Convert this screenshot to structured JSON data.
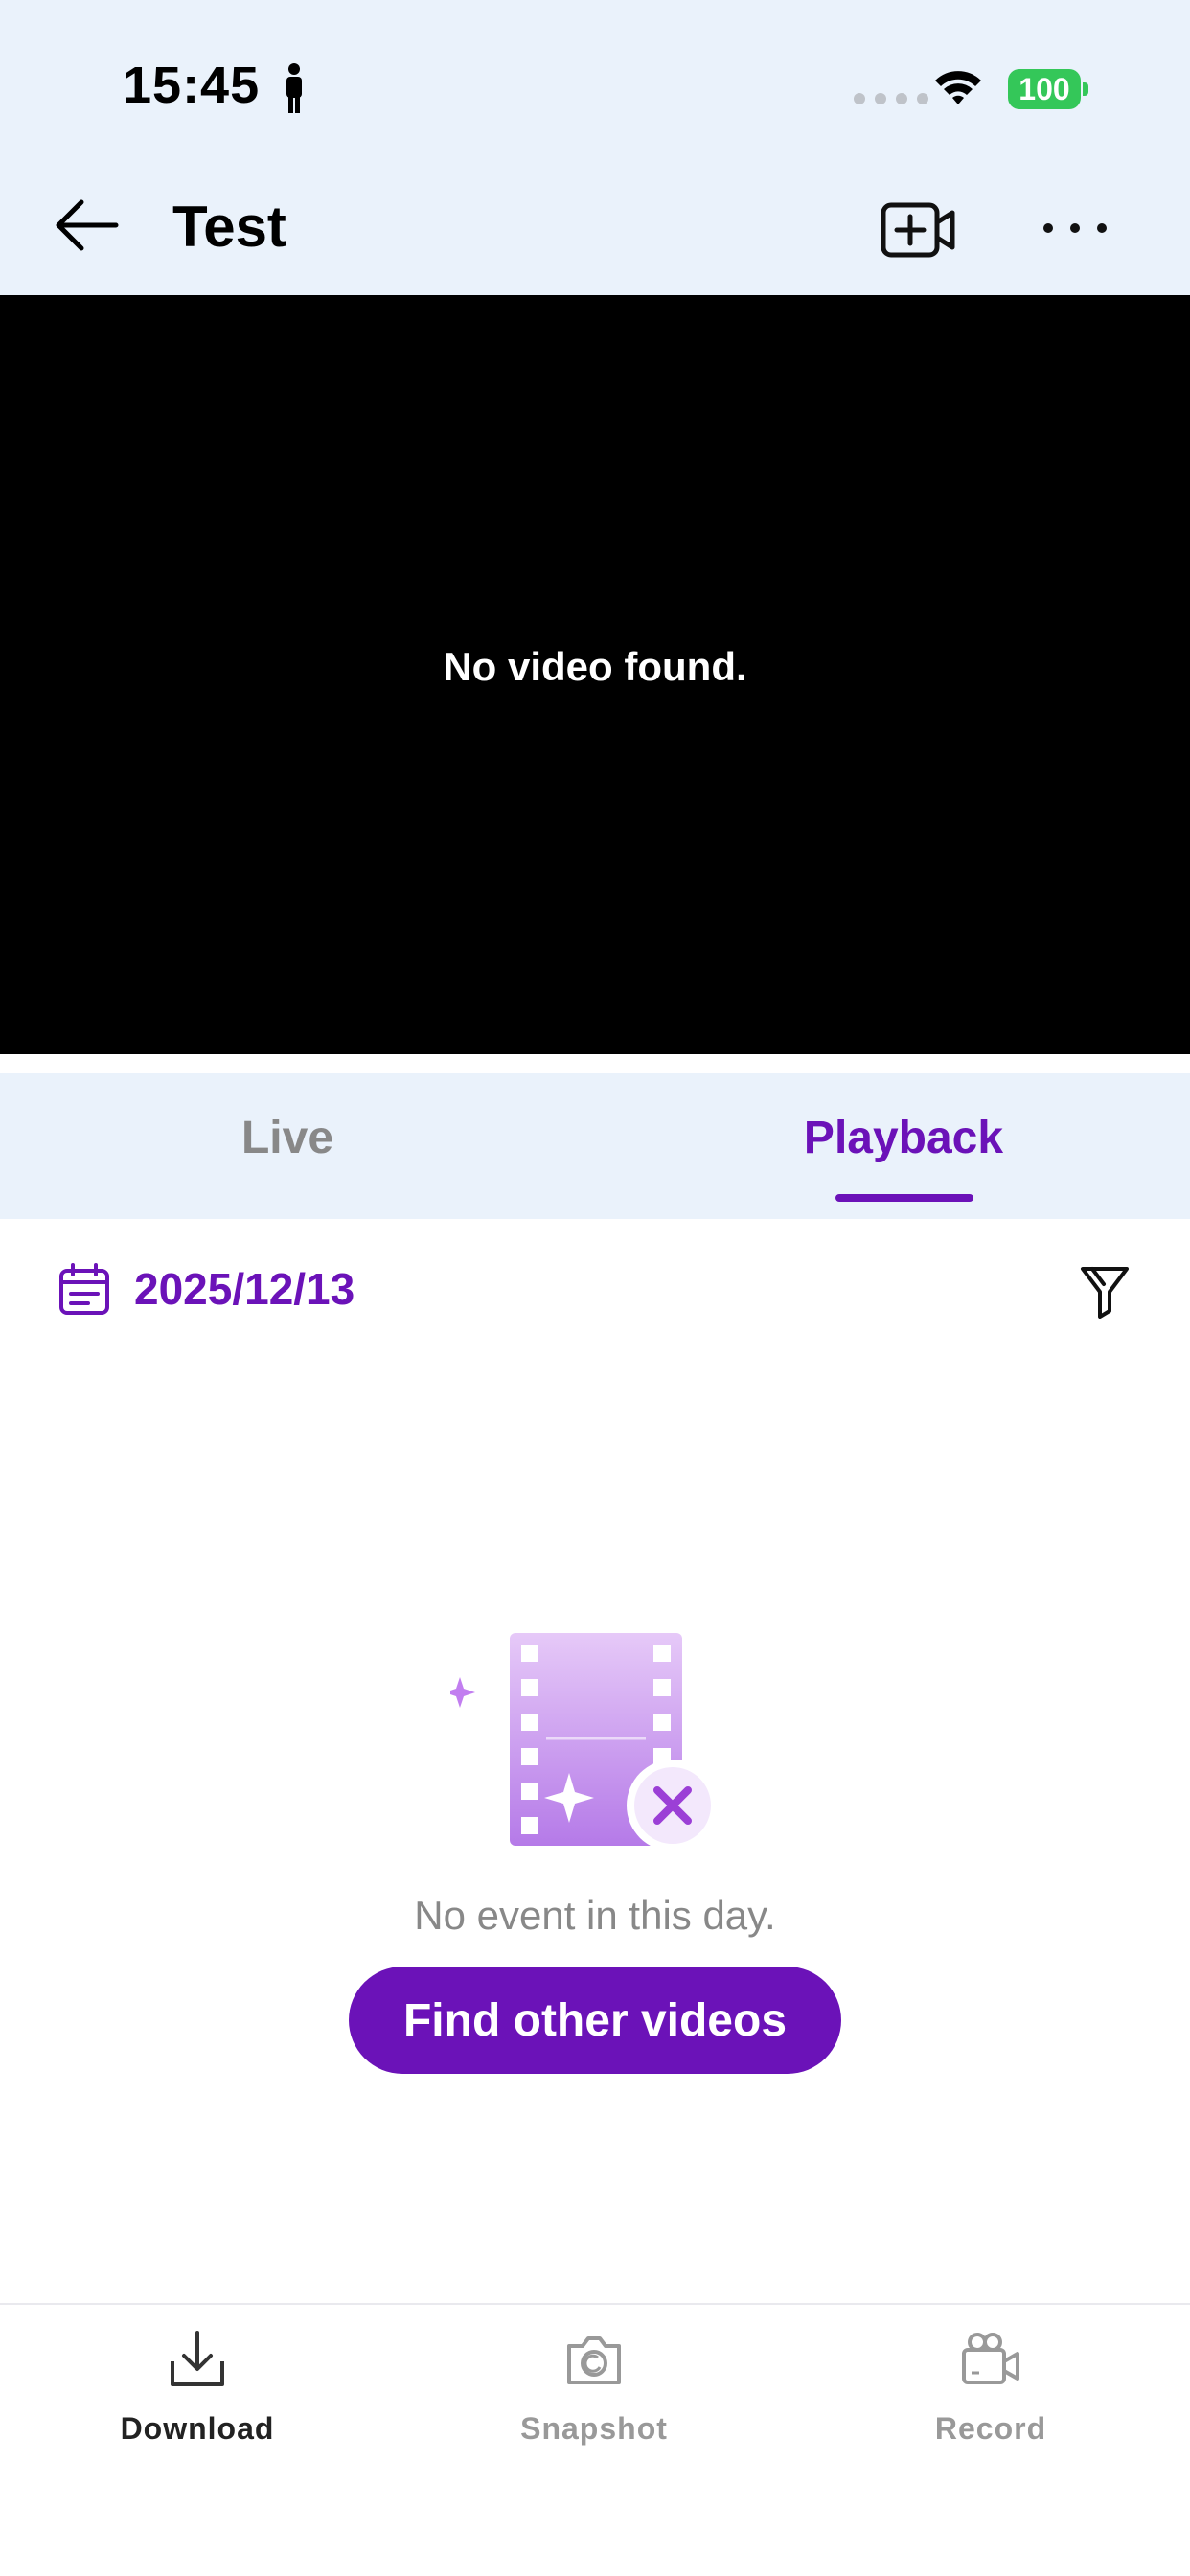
{
  "status_bar": {
    "time": "15:45",
    "battery": "100"
  },
  "header": {
    "title": "Test"
  },
  "video": {
    "message": "No video found."
  },
  "tabs": [
    {
      "label": "Live",
      "active": false
    },
    {
      "label": "Playback",
      "active": true
    }
  ],
  "date_bar": {
    "date": "2025/12/13"
  },
  "empty_state": {
    "message": "No event in this day.",
    "button_label": "Find other videos"
  },
  "bottom_bar": {
    "items": [
      {
        "label": "Download",
        "icon": "download-icon",
        "enabled": true
      },
      {
        "label": "Snapshot",
        "icon": "camera-icon",
        "enabled": false
      },
      {
        "label": "Record",
        "icon": "video-camera-icon",
        "enabled": false
      }
    ]
  },
  "colors": {
    "accent": "#6b12b8",
    "header_bg": "#eaf2fb",
    "battery": "#34c759",
    "muted": "#888888"
  }
}
